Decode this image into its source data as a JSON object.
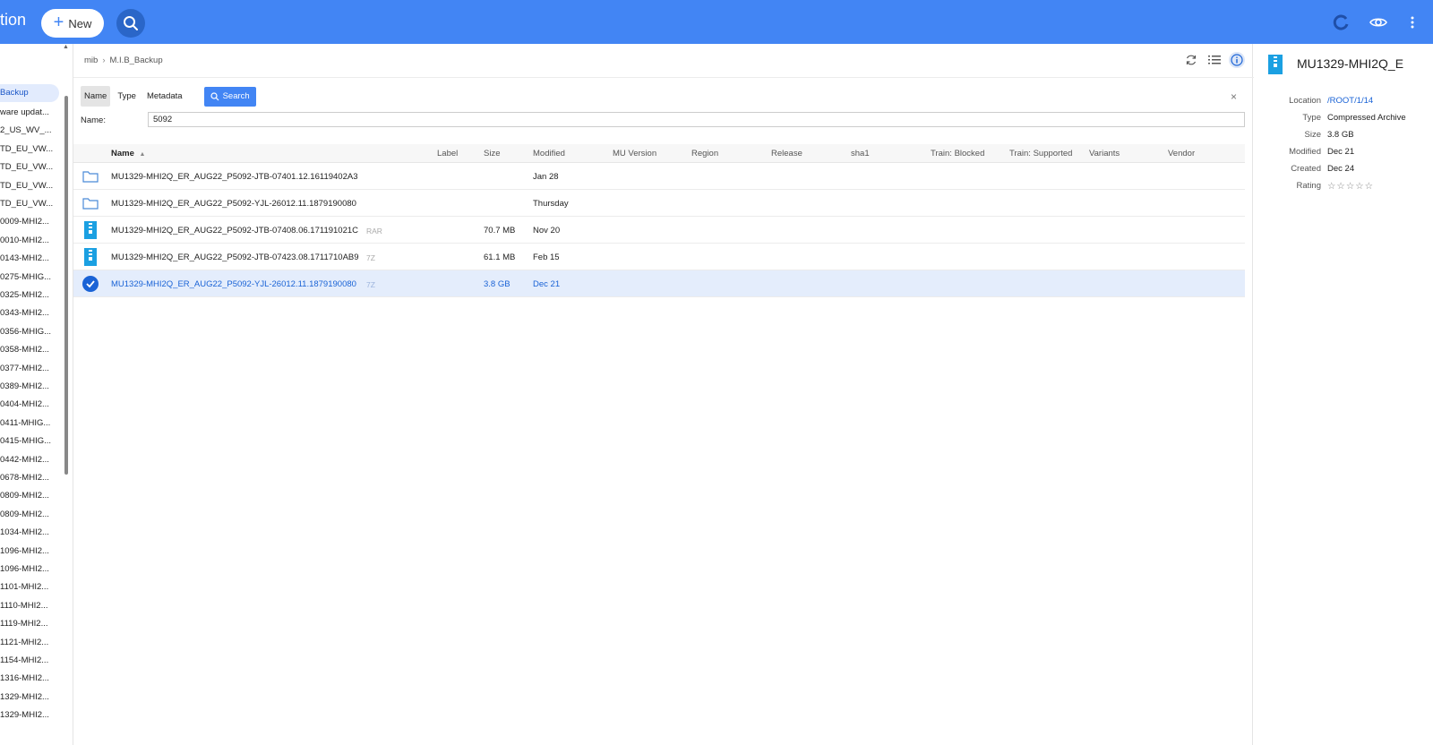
{
  "topbar": {
    "app_title": "tion",
    "new_label": "New",
    "colors": {
      "bar": "#4285f4",
      "accent": "#1a63d6"
    },
    "icons": [
      "search-icon",
      "refresh-icon",
      "eye-icon",
      "more-vert-icon"
    ]
  },
  "sidebar": {
    "items": [
      {
        "label": "Backup",
        "active": true
      },
      {
        "label": "ware updat..."
      },
      {
        "label": "2_US_WV_..."
      },
      {
        "label": "TD_EU_VW..."
      },
      {
        "label": "TD_EU_VW..."
      },
      {
        "label": "TD_EU_VW..."
      },
      {
        "label": "TD_EU_VW..."
      },
      {
        "label": "0009-MHI2..."
      },
      {
        "label": "0010-MHI2..."
      },
      {
        "label": "0143-MHI2..."
      },
      {
        "label": "0275-MHIG..."
      },
      {
        "label": "0325-MHI2..."
      },
      {
        "label": "0343-MHI2..."
      },
      {
        "label": "0356-MHIG..."
      },
      {
        "label": "0358-MHI2..."
      },
      {
        "label": "0377-MHI2..."
      },
      {
        "label": "0389-MHI2..."
      },
      {
        "label": "0404-MHI2..."
      },
      {
        "label": "0411-MHIG..."
      },
      {
        "label": "0415-MHIG..."
      },
      {
        "label": "0442-MHI2..."
      },
      {
        "label": "0678-MHI2..."
      },
      {
        "label": "0809-MHI2..."
      },
      {
        "label": "0809-MHI2..."
      },
      {
        "label": "1034-MHI2..."
      },
      {
        "label": "1096-MHI2..."
      },
      {
        "label": "1096-MHI2..."
      },
      {
        "label": "1101-MHI2..."
      },
      {
        "label": "1110-MHI2..."
      },
      {
        "label": "1119-MHI2..."
      },
      {
        "label": "1121-MHI2..."
      },
      {
        "label": "1154-MHI2..."
      },
      {
        "label": "1316-MHI2..."
      },
      {
        "label": "1329-MHI2..."
      },
      {
        "label": "1329-MHI2..."
      }
    ]
  },
  "breadcrumb": {
    "items": [
      "mib",
      "M.I.B_Backup"
    ],
    "separator": "›"
  },
  "search": {
    "tabs": [
      "Name",
      "Type",
      "Metadata"
    ],
    "button_label": "Search",
    "close_label": "×",
    "name_label": "Name:",
    "name_value": "5092"
  },
  "table": {
    "columns": [
      "Name",
      "Label",
      "Size",
      "Modified",
      "MU Version",
      "Region",
      "Release",
      "sha1",
      "Train: Blocked",
      "Train: Supported",
      "Variants",
      "Vendor"
    ],
    "sort_indicator": "▲",
    "rows": [
      {
        "type": "folder",
        "name": "MU1329-MHI2Q_ER_AUG22_P5092-JTB-07401.12.16119402A3",
        "label": "",
        "size": "",
        "modified": "Jan 28"
      },
      {
        "type": "folder",
        "name": "MU1329-MHI2Q_ER_AUG22_P5092-YJL-26012.11.1879190080",
        "label": "",
        "size": "",
        "modified": "Thursday"
      },
      {
        "type": "archive",
        "name": "MU1329-MHI2Q_ER_AUG22_P5092-JTB-07408.06.171191021C",
        "label": "RAR",
        "size": "70.7 MB",
        "modified": "Nov 20"
      },
      {
        "type": "archive",
        "name": "MU1329-MHI2Q_ER_AUG22_P5092-JTB-07423.08.1711710AB9",
        "label": "7Z",
        "size": "61.1 MB",
        "modified": "Feb 15"
      },
      {
        "type": "selected",
        "name": "MU1329-MHI2Q_ER_AUG22_P5092-YJL-26012.11.1879190080",
        "label": "7Z",
        "size": "3.8 GB",
        "modified": "Dec 21"
      }
    ]
  },
  "details": {
    "title": "MU1329-MHI2Q_E",
    "fields": [
      {
        "key": "Location",
        "value": "/ROOT/1/14",
        "link": true
      },
      {
        "key": "Type",
        "value": "Compressed Archive"
      },
      {
        "key": "Size",
        "value": "3.8 GB"
      },
      {
        "key": "Modified",
        "value": "Dec 21"
      },
      {
        "key": "Created",
        "value": "Dec 24"
      },
      {
        "key": "Rating",
        "value": "☆☆☆☆☆",
        "stars": true
      }
    ]
  }
}
